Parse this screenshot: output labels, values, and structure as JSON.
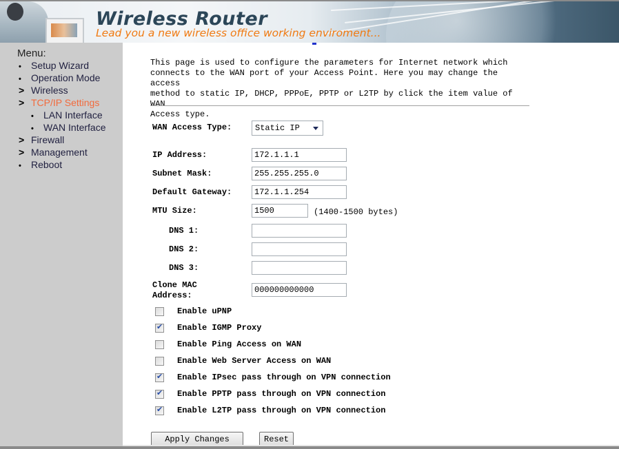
{
  "banner": {
    "title": "Wireless Router",
    "subtitle": "Lead you a new wireless office working enviroment..."
  },
  "sidebar": {
    "title": "Menu:",
    "items": [
      {
        "label": "Setup Wizard",
        "marker": "•",
        "type": "leaf",
        "active": false,
        "indent": 0
      },
      {
        "label": "Operation Mode",
        "marker": "•",
        "type": "leaf",
        "active": false,
        "indent": 0
      },
      {
        "label": "Wireless",
        "marker": ">",
        "type": "folder",
        "active": false,
        "indent": 0
      },
      {
        "label": "TCP/IP Settings",
        "marker": ">",
        "type": "folder",
        "active": true,
        "indent": 0
      },
      {
        "label": "LAN Interface",
        "marker": "•",
        "type": "leaf",
        "active": false,
        "indent": 1
      },
      {
        "label": "WAN Interface",
        "marker": "•",
        "type": "leaf",
        "active": false,
        "indent": 1
      },
      {
        "label": "Firewall",
        "marker": ">",
        "type": "folder",
        "active": false,
        "indent": 0
      },
      {
        "label": "Management",
        "marker": ">",
        "type": "folder",
        "active": false,
        "indent": 0
      },
      {
        "label": "Reboot",
        "marker": "•",
        "type": "leaf",
        "active": false,
        "indent": 0
      }
    ],
    "active_color": "#f26a3c"
  },
  "main": {
    "description": [
      "This page is used to configure the parameters for Internet network which",
      "connects to the WAN port of your Access Point. Here you may change the access",
      "method to static IP, DHCP, PPPoE, PPTP or L2TP by click the item value of WAN",
      "Access type."
    ],
    "wan_access_type": {
      "label": "WAN Access Type:",
      "value": "Static IP"
    },
    "fields": {
      "ip_address": {
        "label": "IP Address:",
        "value": "172.1.1.1"
      },
      "subnet_mask": {
        "label": "Subnet Mask:",
        "value": "255.255.255.0"
      },
      "default_gateway": {
        "label": "Default Gateway:",
        "value": "172.1.1.254"
      },
      "mtu_size": {
        "label": "MTU Size:",
        "value": "1500",
        "hint": "(1400-1500 bytes)"
      },
      "dns1": {
        "label": "DNS 1:",
        "value": ""
      },
      "dns2": {
        "label": "DNS 2:",
        "value": ""
      },
      "dns3": {
        "label": "DNS 3:",
        "value": ""
      },
      "clone_mac": {
        "label_line1": "Clone MAC",
        "label_line2": "Address:",
        "value": "000000000000"
      }
    },
    "options": [
      {
        "label": "Enable uPNP",
        "checked": false
      },
      {
        "label": "Enable IGMP Proxy",
        "checked": true
      },
      {
        "label": "Enable Ping Access on WAN",
        "checked": false
      },
      {
        "label": "Enable Web Server Access on WAN",
        "checked": false
      },
      {
        "label": "Enable IPsec pass through on VPN connection",
        "checked": true
      },
      {
        "label": "Enable PPTP pass through on VPN connection",
        "checked": true
      },
      {
        "label": "Enable L2TP pass through on VPN connection",
        "checked": true
      }
    ],
    "buttons": {
      "apply": "Apply Changes",
      "reset": "Reset"
    }
  }
}
